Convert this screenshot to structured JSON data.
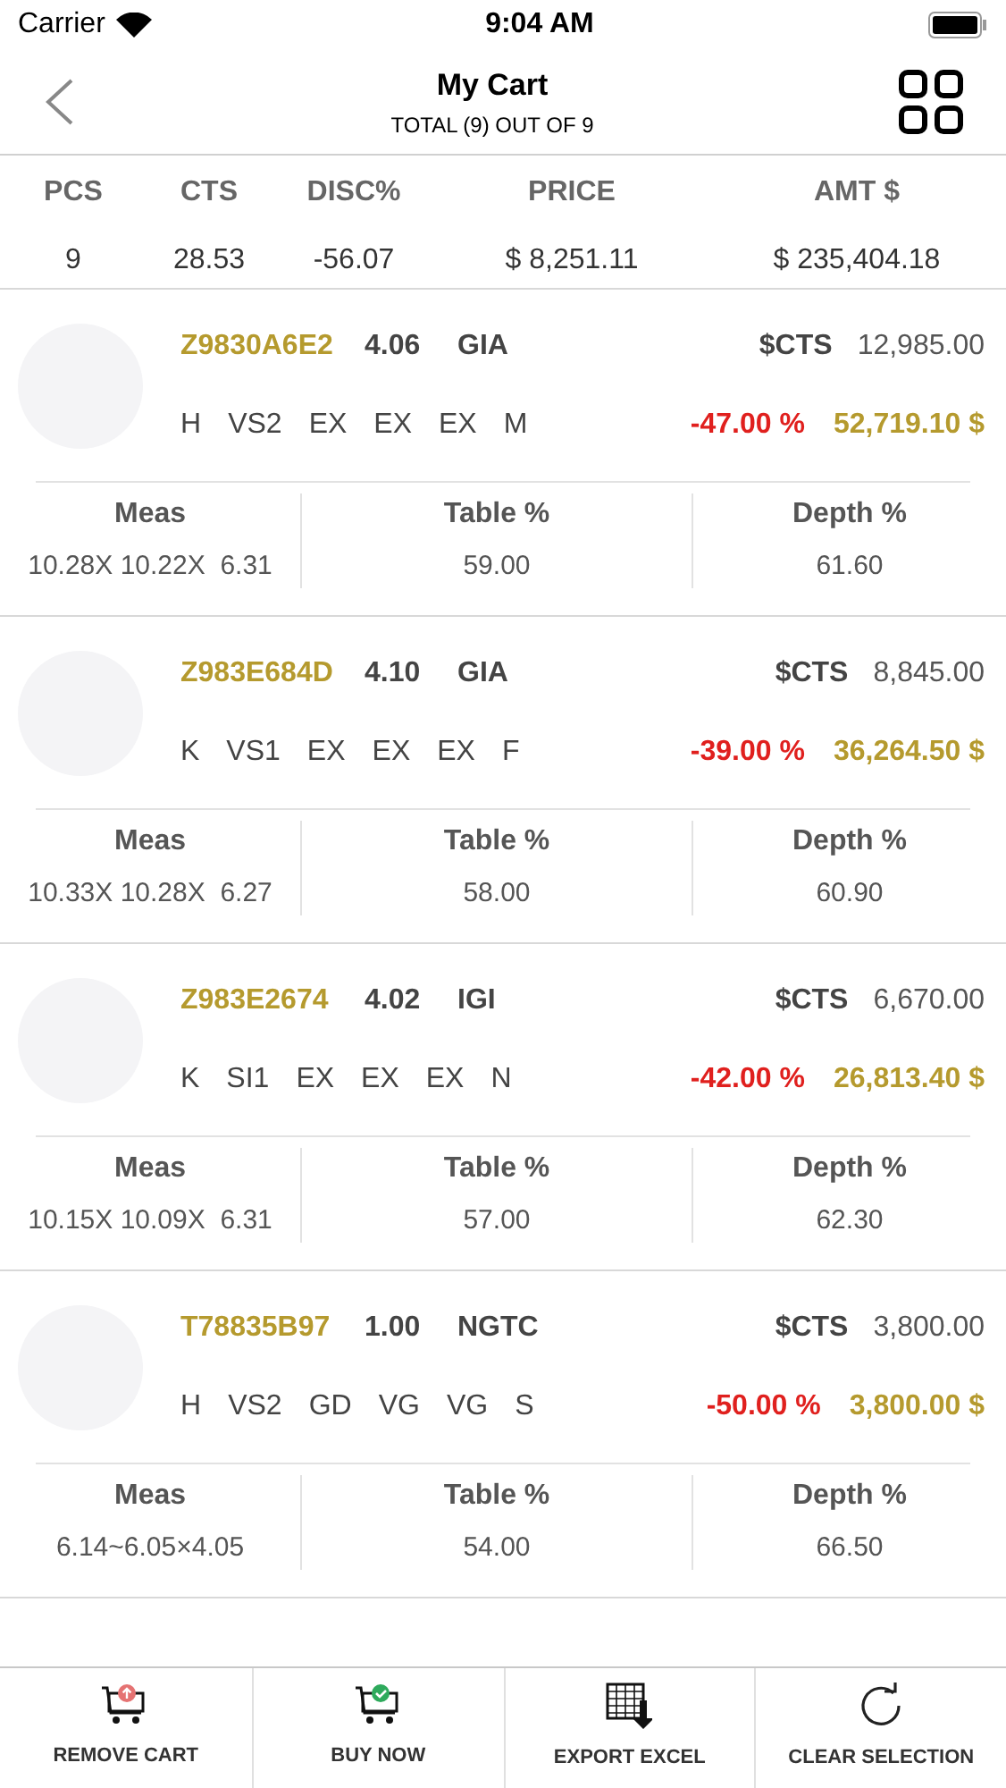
{
  "status_bar": {
    "carrier": "Carrier",
    "time": "9:04 AM"
  },
  "nav": {
    "title": "My Cart",
    "subtitle": "TOTAL (9) OUT OF 9"
  },
  "summary": {
    "columns": [
      {
        "label": "PCS",
        "value": "9"
      },
      {
        "label": "CTS",
        "value": "28.53"
      },
      {
        "label": "DISC%",
        "value": "-56.07"
      },
      {
        "label": "PRICE",
        "value": "$ 8,251.11"
      },
      {
        "label": "AMT $",
        "value": "$ 235,404.18"
      }
    ]
  },
  "items": [
    {
      "stone_id": "Z9830A6E2",
      "carat": "4.06",
      "lab": "GIA",
      "rate_label": "$CTS",
      "rate": "12,985.00",
      "grades": [
        "H",
        "VS2",
        "EX",
        "EX",
        "EX",
        "M"
      ],
      "discount": "-47.00 %",
      "amount": "52,719.10 $",
      "details": [
        {
          "label": "Meas",
          "value": "10.28X 10.22X  6.31"
        },
        {
          "label": "Table %",
          "value": "59.00"
        },
        {
          "label": "Depth %",
          "value": "61.60"
        }
      ]
    },
    {
      "stone_id": "Z983E684D",
      "carat": "4.10",
      "lab": "GIA",
      "rate_label": "$CTS",
      "rate": "8,845.00",
      "grades": [
        "K",
        "VS1",
        "EX",
        "EX",
        "EX",
        "F"
      ],
      "discount": "-39.00 %",
      "amount": "36,264.50 $",
      "details": [
        {
          "label": "Meas",
          "value": "10.33X 10.28X  6.27"
        },
        {
          "label": "Table %",
          "value": "58.00"
        },
        {
          "label": "Depth %",
          "value": "60.90"
        }
      ]
    },
    {
      "stone_id": "Z983E2674",
      "carat": "4.02",
      "lab": "IGI",
      "rate_label": "$CTS",
      "rate": "6,670.00",
      "grades": [
        "K",
        "SI1",
        "EX",
        "EX",
        "EX",
        "N"
      ],
      "discount": "-42.00 %",
      "amount": "26,813.40 $",
      "details": [
        {
          "label": "Meas",
          "value": "10.15X 10.09X  6.31"
        },
        {
          "label": "Table %",
          "value": "57.00"
        },
        {
          "label": "Depth %",
          "value": "62.30"
        }
      ]
    },
    {
      "stone_id": "T78835B97",
      "carat": "1.00",
      "lab": "NGTC",
      "rate_label": "$CTS",
      "rate": "3,800.00",
      "grades": [
        "H",
        "VS2",
        "GD",
        "VG",
        "VG",
        "S"
      ],
      "discount": "-50.00 %",
      "amount": "3,800.00 $",
      "details": [
        {
          "label": "Meas",
          "value": "6.14~6.05×4.05"
        },
        {
          "label": "Table %",
          "value": "54.00"
        },
        {
          "label": "Depth %",
          "value": "66.50"
        }
      ]
    }
  ],
  "actions": [
    {
      "kind": "remove",
      "label": "REMOVE CART"
    },
    {
      "kind": "buy",
      "label": "BUY NOW"
    },
    {
      "kind": "excel",
      "label": "EXPORT EXCEL"
    },
    {
      "kind": "clear",
      "label": "CLEAR SELECTION"
    }
  ]
}
